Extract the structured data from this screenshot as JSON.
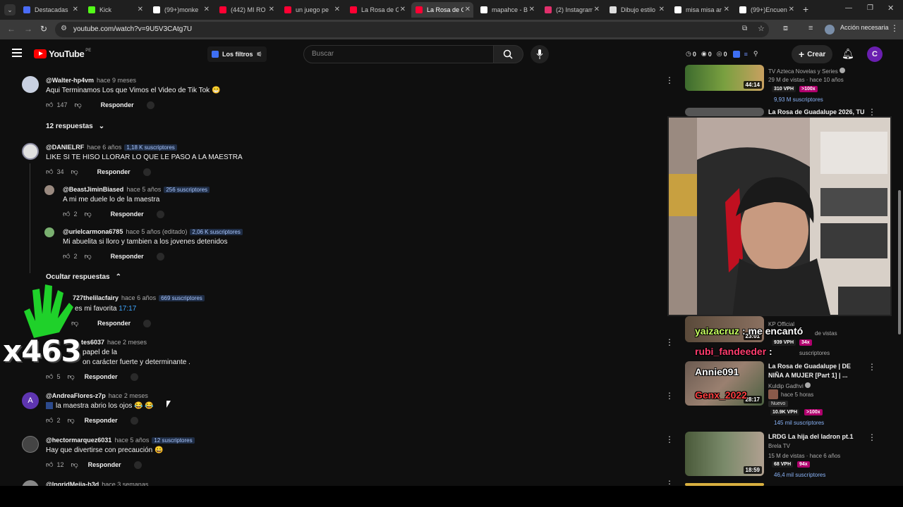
{
  "browser": {
    "tabs": [
      {
        "label": "Destacadas",
        "color": "#4a6cf7"
      },
      {
        "label": "Kick",
        "color": "#53fc18"
      },
      {
        "label": "(99+)monke",
        "color": "#ffffff"
      },
      {
        "label": "(442) MI RO",
        "color": "#ff0033"
      },
      {
        "label": "un juego pe",
        "color": "#ff0033"
      },
      {
        "label": "La Rosa de G",
        "color": "#ff0033"
      },
      {
        "label": "La Rosa de G",
        "color": "#ff0033"
      },
      {
        "label": "mapahce - B",
        "color": "#ffffff"
      },
      {
        "label": "(2) Instagram",
        "color": "#e1306c"
      },
      {
        "label": "Dibujo estilo",
        "color": "#dddddd"
      },
      {
        "label": "misa misa ar",
        "color": "#ffffff"
      },
      {
        "label": "(99+)Encuen",
        "color": "#ffffff"
      }
    ],
    "url": "youtube.com/watch?v=9U5V3CAtg7U",
    "action_label": "Acción necesaria",
    "profile_initial": "C"
  },
  "youtube": {
    "logo": "YouTube",
    "region": "PE",
    "filters_label": "Los filtros",
    "search_placeholder": "Buscar",
    "create_label": "Crear",
    "avatar_initial": "C",
    "counters": [
      "0",
      "0",
      "0"
    ]
  },
  "comments": [
    {
      "handle": "@Walter-hp4vm",
      "time": "hace 9 meses",
      "subs": "",
      "text": "Aqui Terminamos Los que Vimos el Video de Tik Tok 😁",
      "likes": "147",
      "reply": "Responder"
    },
    {
      "handle": "@DANIELRF",
      "time": "hace 6 años",
      "subs": "1,18 K suscriptores",
      "text": "LIKE SI TE HISO LLORAR LO QUE LE PASO A LA MAESTRA",
      "likes": "34",
      "reply": "Responder"
    },
    {
      "handle": "@BeastJiminBiased",
      "time": "hace 5 años",
      "subs": "256 suscriptores",
      "text": "A mi me duele lo de la maestra",
      "likes": "2",
      "reply": "Responder"
    },
    {
      "handle": "@urielcarmona6785",
      "time": "hace 5 años (editado)",
      "subs": "2,06 K suscriptores",
      "text": "Mi abuelita si lloro y tambien a los jovenes detenidos",
      "likes": "2",
      "reply": "Responder"
    },
    {
      "handle": "727thelilacfairy",
      "time": "hace 6 años",
      "subs": "669 suscriptores",
      "text": "es mi favorita",
      "timestamp": "17:17",
      "likes": "",
      "reply": "Responder"
    },
    {
      "handle": "tes6037",
      "time": "hace 2 meses",
      "subs": "",
      "text1": "papel de la",
      "text2": "on carácter fuerte y determinante .",
      "likes": "5",
      "reply": "Responder"
    },
    {
      "handle": "@AndreaFlores-z7p",
      "time": "hace 2 meses",
      "subs": "",
      "text": "la maestra abrio los ojos 😂 😂",
      "likes": "2",
      "reply": "Responder"
    },
    {
      "handle": "@hectormarquez6031",
      "time": "hace 5 años",
      "subs": "12 suscriptores",
      "text": "Hay que divertirse con precaución 😀",
      "likes": "12",
      "reply": "Responder"
    },
    {
      "handle": "@IngridMejia-b3d",
      "time": "hace 3 semanas"
    }
  ],
  "toggles": {
    "show_replies": "12 respuestas",
    "hide_replies": "Ocultar respuestas"
  },
  "sidebar_videos": [
    {
      "channel": "TV Azteca Novelas y Series",
      "meta": "29 M de vistas · hace 10 años",
      "vph": "310 VPH",
      "mult": ">100x",
      "subs": "9,93 M suscriptores",
      "duration": "44:14"
    },
    {
      "title": "La Rosa de Guadalupe 2026, TU"
    },
    {
      "channel": "KP Official",
      "meta": "de vistas",
      "vph": "939 VPH",
      "mult": "34x",
      "subs": "suscriptores",
      "duration": "23:01"
    },
    {
      "title1": "La Rosa de Guadalupe | DE",
      "title2": "NIÑA A MUJER [Part 1] | ...",
      "channel": "Kuldip Gadhvi",
      "meta": "hace 5 horas",
      "badge": "Nuevo",
      "vph": "10.9K VPH",
      "mult": ">100x",
      "subs": "145 mil suscriptores",
      "duration": "28:17"
    },
    {
      "title": "LRDG La hija del ladron pt.1",
      "channel": "Brela TV",
      "meta": "15 M de vistas · hace 6 años",
      "vph": "68 VPH",
      "mult": "94x",
      "subs": "46,4 mil suscriptores",
      "duration": "18:59"
    }
  ],
  "overlays": {
    "chat": [
      {
        "user": "yaizacruz",
        "sep": ":",
        "msg": "me encantó"
      },
      {
        "user": "rubi_fandeeder",
        "sep": ":",
        "msg": ""
      },
      {
        "user": "Annie091",
        "sep": "",
        "msg": ""
      },
      {
        "user": "Genx_2022",
        "sep": "",
        "msg": ""
      }
    ],
    "multiplier": "x463"
  }
}
